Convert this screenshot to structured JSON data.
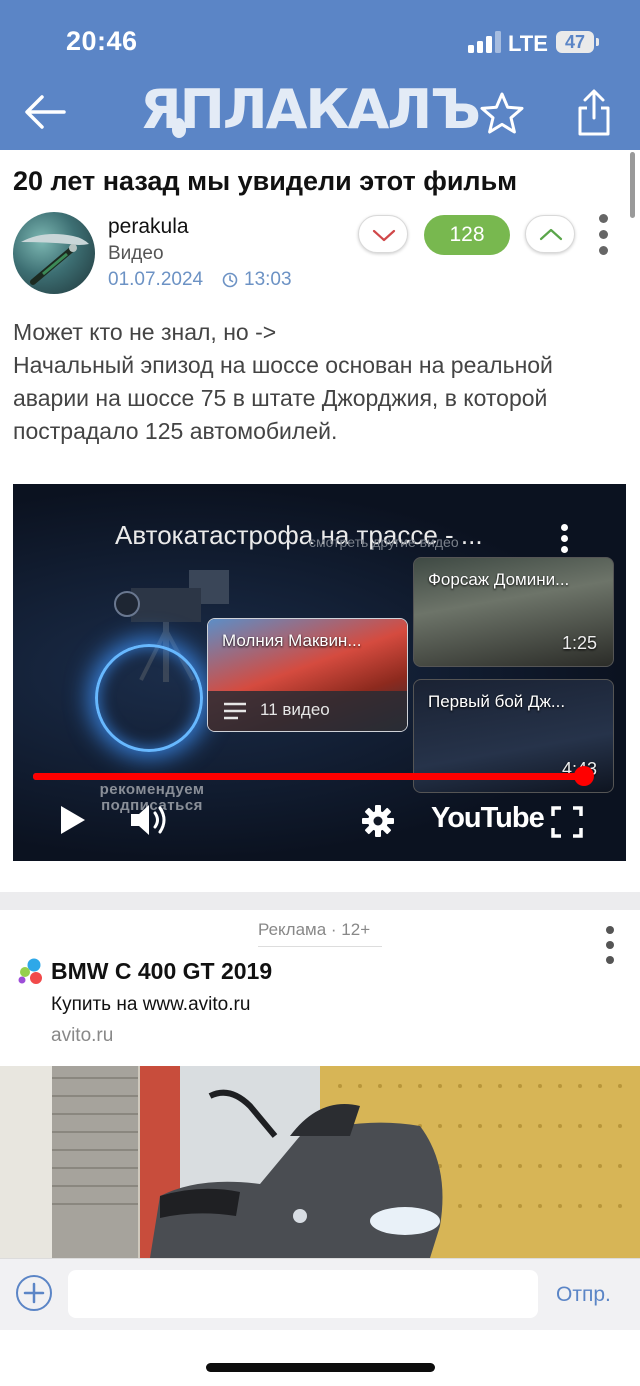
{
  "status_bar": {
    "time": "20:46",
    "network": "LTE",
    "battery": "47"
  },
  "header": {
    "logo_text": "ЯПЛАКАЛЪ",
    "icons": [
      "back-arrow-icon",
      "star-icon",
      "share-icon"
    ],
    "color": "#5b85c6"
  },
  "post": {
    "title": "20 лет назад мы увидели этот фильм",
    "author": "perakula",
    "category": "Видео",
    "date": "01.07.2024",
    "time": "13:03",
    "rating": "128",
    "rating_color": "#78b84f",
    "text": "Может кто не знал, но ->\nНачальный эпизод на шоссе основан на реальной аварии на шоссе 75 в штате Джорджия, в которой пострадало 125 автомобилей.",
    "video": {
      "title": "Автокатастрофа на трассе - ...",
      "more_videos_label": "смотреть другие видео",
      "playlist": {
        "title": "Молния Маквин...",
        "count": "11 видео"
      },
      "related": [
        {
          "title": "Форсаж Домини...",
          "duration": "1:25"
        },
        {
          "title": "Первый бой Дж...",
          "duration": "4:43"
        }
      ],
      "progress": 0.99,
      "recommend_text": "рекомендуем подписаться",
      "youtube_label": "YouTube"
    }
  },
  "ad": {
    "label": "Реклама · 12+",
    "title": "BMW C 400 GT 2019",
    "subtitle": "Купить на www.avito.ru",
    "domain": "avito.ru"
  },
  "comment_bar": {
    "input_placeholder": "",
    "send_label": "Отпр."
  }
}
